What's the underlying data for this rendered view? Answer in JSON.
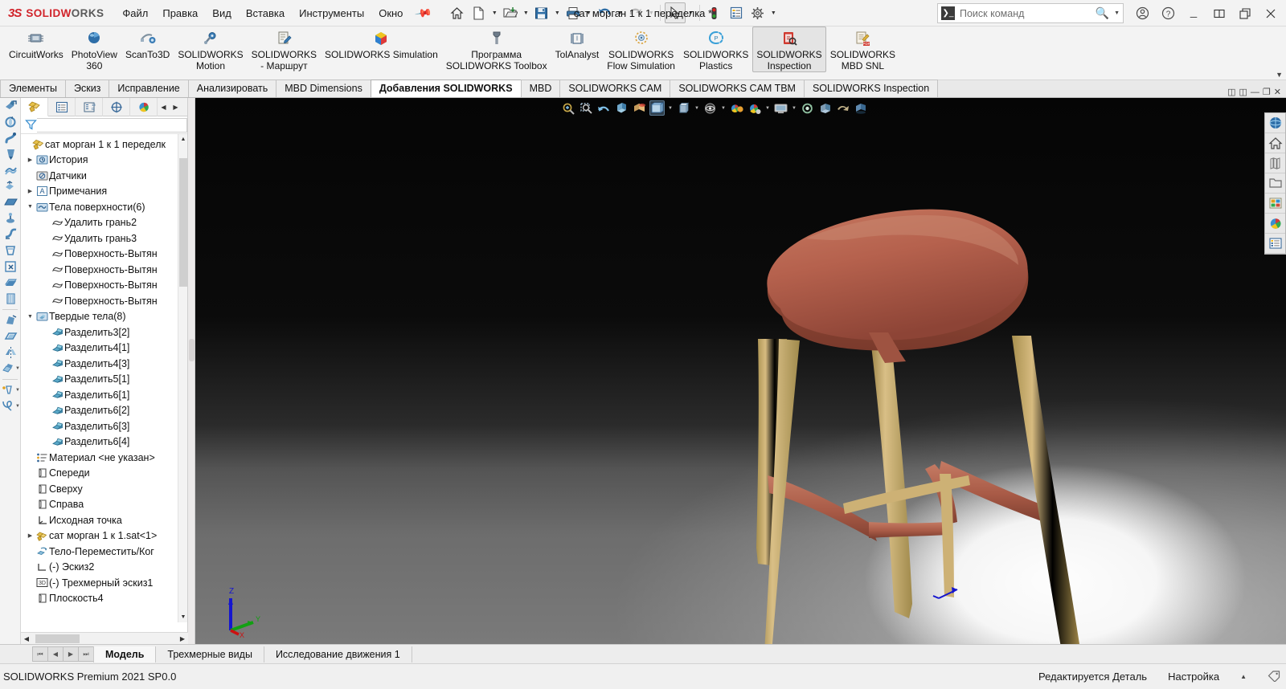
{
  "app": {
    "brand_mark": "3S",
    "brand_word_1": "SOLID",
    "brand_word_2": "W",
    "brand_word_3": "ORKS",
    "document_title": "сат морган 1 к 1 переделка *",
    "accent_red": "#d1232a",
    "seat_color": "#b5614d",
    "leg_color": "#cdae72"
  },
  "menu": {
    "items": [
      {
        "label": "Файл"
      },
      {
        "label": "Правка"
      },
      {
        "label": "Вид"
      },
      {
        "label": "Вставка"
      },
      {
        "label": "Инструменты"
      },
      {
        "label": "Окно"
      }
    ],
    "pin_icon": "pin-icon"
  },
  "quick_access": {
    "buttons": [
      {
        "name": "home-icon",
        "label": "Домой",
        "dropdown": false
      },
      {
        "name": "new-document-icon",
        "label": "Создать",
        "dropdown": true
      },
      {
        "name": "open-folder-icon",
        "label": "Открыть",
        "dropdown": true
      },
      {
        "name": "save-icon",
        "label": "Сохранить",
        "dropdown": true
      },
      {
        "name": "print-icon",
        "label": "Печать",
        "dropdown": true
      },
      {
        "name": "undo-icon",
        "label": "Отменить",
        "dropdown": true
      },
      {
        "name": "redo-icon",
        "label": "Повторить",
        "dropdown": true
      },
      {
        "name": "select-cursor-icon",
        "label": "Выбрать",
        "dropdown": true,
        "selected": true
      },
      {
        "name": "rebuild-icon",
        "label": "Перестроить",
        "dropdown": false
      },
      {
        "name": "file-properties-icon",
        "label": "Свойства файла",
        "dropdown": false
      },
      {
        "name": "options-gear-icon",
        "label": "Настройки",
        "dropdown": true
      }
    ]
  },
  "search": {
    "placeholder": "Поиск команд",
    "value": "",
    "icon": "command-search-icon",
    "magnifier": "magnifier-icon"
  },
  "window_controls": [
    {
      "name": "user-account-icon",
      "glyph": "ⓘ"
    },
    {
      "name": "help-icon",
      "glyph": "?"
    },
    {
      "name": "minimize-button",
      "glyph": "—"
    },
    {
      "name": "restore-button",
      "glyph": "▣"
    },
    {
      "name": "maximize-button",
      "glyph": "❐"
    },
    {
      "name": "close-button",
      "glyph": "✕"
    }
  ],
  "ribbon": {
    "buttons": [
      {
        "label": "CircuitWorks",
        "icon": "circuitworks-icon",
        "active": false
      },
      {
        "label": "PhotoView\n360",
        "icon": "photoview-sphere-icon",
        "active": false
      },
      {
        "label": "ScanTo3D",
        "icon": "scanto3d-icon",
        "active": false
      },
      {
        "label": "SOLIDWORKS\nMotion",
        "icon": "motion-icon",
        "active": false
      },
      {
        "label": "SOLIDWORKS\n- Маршрут",
        "icon": "routing-icon",
        "active": false
      },
      {
        "label": "SOLIDWORKS Simulation",
        "icon": "simulation-cube-icon",
        "active": false
      },
      {
        "label": "Программа\nSOLIDWORKS Toolbox",
        "icon": "toolbox-icon",
        "active": false
      },
      {
        "label": "TolAnalyst",
        "icon": "tolanalyst-icon",
        "active": false
      },
      {
        "label": "SOLIDWORKS\nFlow Simulation",
        "icon": "flow-simulation-icon",
        "active": false
      },
      {
        "label": "SOLIDWORKS\nPlastics",
        "icon": "plastics-icon",
        "active": false
      },
      {
        "label": "SOLIDWORKS\nInspection",
        "icon": "inspection-icon",
        "active": true
      },
      {
        "label": "SOLIDWORKS\nMBD SNL",
        "icon": "mbd-snl-icon",
        "active": false
      }
    ],
    "expand_caret": "chevron-down-icon"
  },
  "tabs": {
    "items": [
      {
        "label": "Элементы",
        "selected": false
      },
      {
        "label": "Эскиз",
        "selected": false
      },
      {
        "label": "Исправление",
        "selected": false
      },
      {
        "label": "Анализировать",
        "selected": false
      },
      {
        "label": "MBD Dimensions",
        "selected": false
      },
      {
        "label": "Добавления SOLIDWORKS",
        "selected": true
      },
      {
        "label": "MBD",
        "selected": false
      },
      {
        "label": "SOLIDWORKS CAM",
        "selected": false
      },
      {
        "label": "SOLIDWORKS CAM TBM",
        "selected": false
      },
      {
        "label": "SOLIDWORKS Inspection",
        "selected": false
      }
    ]
  },
  "left_rail": {
    "items": [
      {
        "name": "extruded-boss-icon"
      },
      {
        "name": "revolved-boss-icon"
      },
      {
        "name": "swept-boss-icon"
      },
      {
        "name": "lofted-boss-icon"
      },
      {
        "name": "boundary-boss-icon"
      },
      {
        "name": "extruded-cut-icon"
      },
      {
        "name": "planar-surface-icon"
      },
      {
        "name": "revolved-cut-icon"
      },
      {
        "name": "swept-cut-icon"
      },
      {
        "name": "lofted-cut-icon"
      },
      {
        "name": "delete-face-icon"
      },
      {
        "name": "thicken-icon"
      },
      {
        "name": "rib-icon"
      },
      {
        "name": "draft-icon"
      },
      {
        "name": "shell-icon"
      },
      {
        "name": "mirror-icon"
      },
      {
        "name": "pattern-icon",
        "dropdown": true
      },
      {
        "name": "reference-geometry-icon",
        "dropdown": true
      },
      {
        "name": "curves-icon",
        "dropdown": true
      }
    ]
  },
  "tree_panel": {
    "tabs": [
      {
        "name": "feature-manager-tab",
        "icon": "feature-tree-icon",
        "selected": true
      },
      {
        "name": "property-manager-tab",
        "icon": "property-list-icon",
        "selected": false
      },
      {
        "name": "configuration-manager-tab",
        "icon": "configurations-icon",
        "selected": false
      },
      {
        "name": "dimxpert-manager-tab",
        "icon": "dimxpert-icon",
        "selected": false
      },
      {
        "name": "display-manager-tab",
        "icon": "display-palette-icon",
        "selected": false
      }
    ],
    "nav_prev": "chevron-left-icon",
    "nav_next": "chevron-right-icon",
    "filter_icon": "filter-funnel-icon",
    "filter_value": "",
    "root": {
      "label": "сат морган 1 к 1 переделк",
      "icon": "part-icon",
      "collapse": "chevron-up-icon"
    },
    "nodes": [
      {
        "label": "История",
        "icon": "history-icon",
        "indent": 0,
        "expander": "collapsed"
      },
      {
        "label": "Датчики",
        "icon": "sensors-icon",
        "indent": 0,
        "expander": "none"
      },
      {
        "label": "Примечания",
        "icon": "annotations-icon",
        "indent": 0,
        "expander": "collapsed"
      },
      {
        "label": "Тела поверхности(6)",
        "icon": "surface-bodies-folder-icon",
        "indent": 0,
        "expander": "expanded"
      },
      {
        "label": "Удалить грань2",
        "icon": "surface-body-icon",
        "indent": 1,
        "expander": "none"
      },
      {
        "label": "Удалить грань3",
        "icon": "surface-body-icon",
        "indent": 1,
        "expander": "none"
      },
      {
        "label": "Поверхность-Вытян",
        "icon": "surface-body-icon",
        "indent": 1,
        "expander": "none"
      },
      {
        "label": "Поверхность-Вытян",
        "icon": "surface-body-icon",
        "indent": 1,
        "expander": "none"
      },
      {
        "label": "Поверхность-Вытян",
        "icon": "surface-body-icon",
        "indent": 1,
        "expander": "none"
      },
      {
        "label": "Поверхность-Вытян",
        "icon": "surface-body-icon",
        "indent": 1,
        "expander": "none"
      },
      {
        "label": "Твердые тела(8)",
        "icon": "solid-bodies-folder-icon",
        "indent": 0,
        "expander": "expanded"
      },
      {
        "label": "Разделить3[2]",
        "icon": "solid-body-icon",
        "indent": 1,
        "expander": "none"
      },
      {
        "label": "Разделить4[1]",
        "icon": "solid-body-icon",
        "indent": 1,
        "expander": "none"
      },
      {
        "label": "Разделить4[3]",
        "icon": "solid-body-icon",
        "indent": 1,
        "expander": "none"
      },
      {
        "label": "Разделить5[1]",
        "icon": "solid-body-icon",
        "indent": 1,
        "expander": "none"
      },
      {
        "label": "Разделить6[1]",
        "icon": "solid-body-icon",
        "indent": 1,
        "expander": "none"
      },
      {
        "label": "Разделить6[2]",
        "icon": "solid-body-icon",
        "indent": 1,
        "expander": "none"
      },
      {
        "label": "Разделить6[3]",
        "icon": "solid-body-icon",
        "indent": 1,
        "expander": "none"
      },
      {
        "label": "Разделить6[4]",
        "icon": "solid-body-icon",
        "indent": 1,
        "expander": "none"
      },
      {
        "label": "Материал <не указан>",
        "icon": "material-icon",
        "indent": 0,
        "expander": "none"
      },
      {
        "label": "Спереди",
        "icon": "plane-icon",
        "indent": 0,
        "expander": "none"
      },
      {
        "label": "Сверху",
        "icon": "plane-icon",
        "indent": 0,
        "expander": "none"
      },
      {
        "label": "Справа",
        "icon": "plane-icon",
        "indent": 0,
        "expander": "none"
      },
      {
        "label": "Исходная точка",
        "icon": "origin-icon",
        "indent": 0,
        "expander": "none"
      },
      {
        "label": "сат морган 1 к 1.sat<1>",
        "icon": "imported-part-icon",
        "indent": 0,
        "expander": "collapsed"
      },
      {
        "label": "Тело-Переместить/Ког",
        "icon": "move-copy-body-icon",
        "indent": 0,
        "expander": "none"
      },
      {
        "label": "(-) Эскиз2",
        "icon": "sketch-icon",
        "indent": 0,
        "expander": "none"
      },
      {
        "label": "(-) Трехмерный эскиз1",
        "icon": "sketch3d-icon",
        "indent": 0,
        "expander": "none"
      },
      {
        "label": "Плоскость4",
        "icon": "plane-icon",
        "indent": 0,
        "expander": "none"
      }
    ],
    "scroll_up": "chevron-up-icon",
    "scroll_down": "chevron-down-icon",
    "hscroll_left": "chevron-left-icon",
    "hscroll_right": "chevron-right-icon"
  },
  "viewport_hud": {
    "buttons": [
      {
        "name": "zoom-to-fit-icon",
        "dropdown": false
      },
      {
        "name": "zoom-to-area-icon",
        "dropdown": false
      },
      {
        "name": "previous-view-icon",
        "dropdown": false
      },
      {
        "name": "section-view-icon",
        "dropdown": false
      },
      {
        "name": "view-orientation-icon",
        "dropdown": false
      },
      {
        "name": "display-style-icon",
        "dropdown": true,
        "selected": true
      },
      {
        "name": "hide-show-items-icon",
        "dropdown": true
      },
      {
        "name": "edit-appearance-icon",
        "dropdown": true
      },
      {
        "name": "apply-scene-icon",
        "dropdown": false
      },
      {
        "name": "view-settings-icon",
        "dropdown": true
      },
      {
        "name": "display-monitor-icon",
        "dropdown": true
      },
      {
        "name": "rotate-view-icon",
        "dropdown": false
      },
      {
        "name": "perspective-icon",
        "dropdown": false
      },
      {
        "name": "realview-icon",
        "dropdown": false
      },
      {
        "name": "ambient-occlusion-icon",
        "dropdown": false
      }
    ]
  },
  "right_rail": {
    "items": [
      {
        "name": "3dexperience-sphere-icon"
      },
      {
        "name": "home-task-pane-icon"
      },
      {
        "name": "design-library-icon"
      },
      {
        "name": "file-explorer-icon"
      },
      {
        "name": "view-palette-icon"
      },
      {
        "name": "appearances-scenes-icon"
      },
      {
        "name": "custom-properties-icon"
      }
    ]
  },
  "viewport_corner": {
    "buttons": [
      {
        "name": "tile-horizontally-icon",
        "glyph": "◫"
      },
      {
        "name": "tile-vertically-icon",
        "glyph": "◫"
      },
      {
        "name": "minimize-view-button",
        "glyph": "—"
      },
      {
        "name": "restore-view-button",
        "glyph": "❐"
      },
      {
        "name": "close-view-button",
        "glyph": "✕"
      }
    ]
  },
  "triad": {
    "axis_z": "Z",
    "axis_y": "Y",
    "axis_x": "X",
    "color_z": "#1515d0",
    "color_y": "#12a012",
    "color_x": "#cc1111"
  },
  "bottom_tabs": {
    "nav": [
      {
        "name": "first-tab-button",
        "glyph": "⏮"
      },
      {
        "name": "prev-tab-button",
        "glyph": "◀"
      },
      {
        "name": "next-tab-button",
        "glyph": "▶"
      },
      {
        "name": "last-tab-button",
        "glyph": "⏭"
      }
    ],
    "items": [
      {
        "label": "Модель",
        "selected": true
      },
      {
        "label": "Трехмерные виды",
        "selected": false
      },
      {
        "label": "Исследование движения 1",
        "selected": false
      }
    ]
  },
  "status_bar": {
    "left": "SOLIDWORKS Premium 2021 SP0.0",
    "editing": "Редактируется Деталь",
    "config": "Настройка",
    "config_caret": "chevron-up-icon",
    "tag_icon": "tag-icon"
  }
}
